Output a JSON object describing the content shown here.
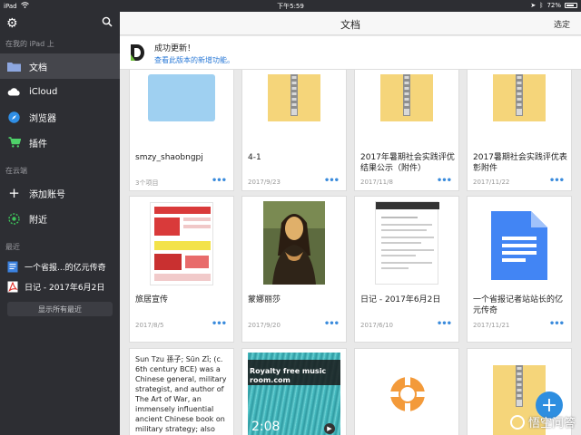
{
  "status": {
    "device": "iPad",
    "time": "下午5:59",
    "battery": "72%"
  },
  "sidebar": {
    "section_local": "在我的 iPad 上",
    "local_items": [
      {
        "label": "文档",
        "icon": "folder-icon",
        "active": true
      },
      {
        "label": "iCloud",
        "icon": "cloud-icon"
      },
      {
        "label": "浏览器",
        "icon": "compass-icon"
      },
      {
        "label": "插件",
        "icon": "cart-icon"
      }
    ],
    "section_cloud": "在云端",
    "cloud_items": [
      {
        "label": "添加账号",
        "icon": "plus-icon"
      },
      {
        "label": "附近",
        "icon": "nearby-icon"
      }
    ],
    "section_recent": "最近",
    "recent_items": [
      {
        "label": "一个省报...的亿元传奇",
        "icon": "doc-icon"
      },
      {
        "label": "日记 - 2017年6月2日",
        "icon": "pdf-icon"
      }
    ],
    "show_all": "显示所有最近"
  },
  "navbar": {
    "title": "文档",
    "select": "选定"
  },
  "banner": {
    "title": "成功更新！",
    "subtitle": "查看此版本的新增功能。"
  },
  "files": [
    {
      "name": "smzy_shaobngpj",
      "date": "3个项目",
      "type": "folder"
    },
    {
      "name": "4-1",
      "date": "2017/9/23",
      "type": "zip"
    },
    {
      "name": "2017年暑期社会实践评优结果公示（附件）",
      "date": "2017/11/8",
      "type": "zip"
    },
    {
      "name": "2017暑期社会实践评优表彰附件",
      "date": "2017/11/22",
      "type": "zip"
    },
    {
      "name": "旅居宣传",
      "date": "2017/8/5",
      "type": "poster"
    },
    {
      "name": "蒙娜丽莎",
      "date": "2017/9/20",
      "type": "painting"
    },
    {
      "name": "日记 - 2017年6月2日",
      "date": "2017/6/10",
      "type": "pdf"
    },
    {
      "name": "一个省报记者站站长的亿元传奇",
      "date": "2017/11/21",
      "type": "gdoc"
    },
    {
      "name": "",
      "date": "",
      "type": "text",
      "preview": "Sun Tzu 孫子; Sūn Zǐ; (c. 6th century BCE) was a Chinese general, military strategist, and author of The Art of War, an immensely influential ancient Chinese book on military strategy; also known as Sun Wu (孫武;"
    },
    {
      "name": "",
      "date": "",
      "type": "video",
      "overlay": "Royalty free music room.com",
      "duration": "2:08"
    },
    {
      "name": "",
      "date": "",
      "type": "help"
    },
    {
      "name": "",
      "date": "",
      "type": "zip"
    }
  ],
  "colors": {
    "sidebar_bg": "#2d2e33",
    "accent": "#2b7ad7",
    "zip_yellow": "#f5d57a"
  },
  "watermark": "悟空问答"
}
